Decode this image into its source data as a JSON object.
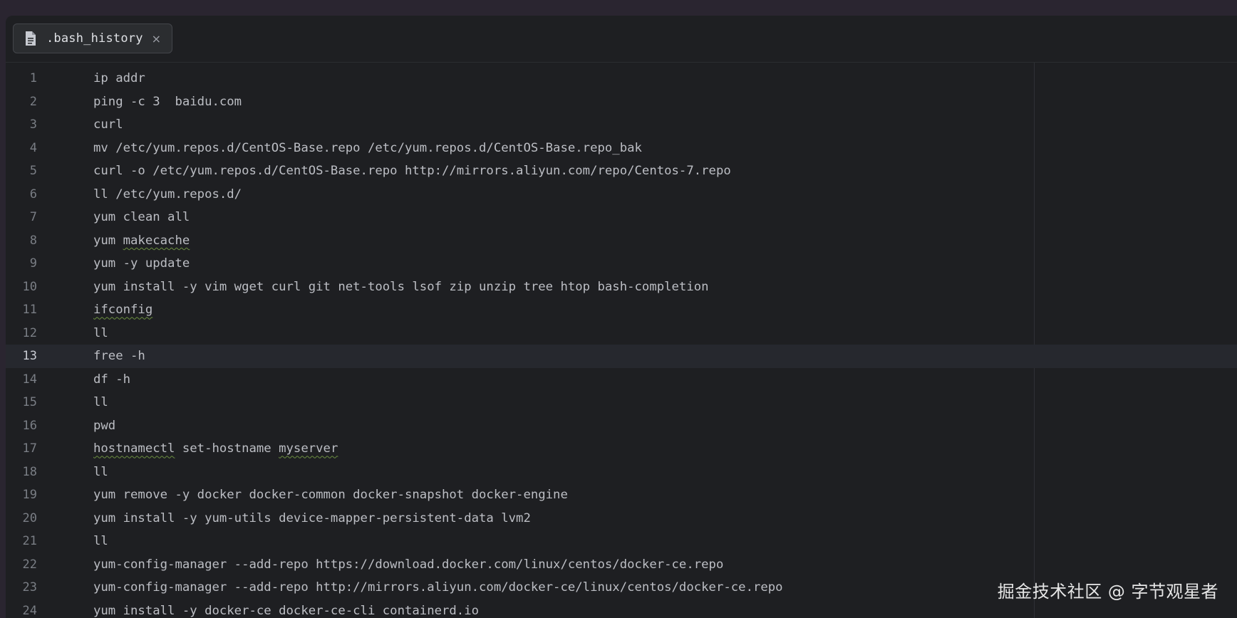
{
  "tab": {
    "label": ".bash_history",
    "icon": "file-icon",
    "close_glyph": "×"
  },
  "editor": {
    "current_line": 13,
    "lines": [
      {
        "n": "1",
        "text": "ip addr"
      },
      {
        "n": "2",
        "text": "ping -c 3  baidu.com"
      },
      {
        "n": "3",
        "text": "curl"
      },
      {
        "n": "4",
        "text": "mv /etc/yum.repos.d/CentOS-Base.repo /etc/yum.repos.d/CentOS-Base.repo_bak"
      },
      {
        "n": "5",
        "text": "curl -o /etc/yum.repos.d/CentOS-Base.repo http://mirrors.aliyun.com/repo/Centos-7.repo"
      },
      {
        "n": "6",
        "text": "ll /etc/yum.repos.d/"
      },
      {
        "n": "7",
        "text": "yum clean all"
      },
      {
        "n": "8",
        "text": "yum makecache",
        "typos": [
          "makecache"
        ]
      },
      {
        "n": "9",
        "text": "yum -y update"
      },
      {
        "n": "10",
        "text": "yum install -y vim wget curl git net-tools lsof zip unzip tree htop bash-completion"
      },
      {
        "n": "11",
        "text": "ifconfig",
        "typos": [
          "ifconfig"
        ]
      },
      {
        "n": "12",
        "text": "ll"
      },
      {
        "n": "13",
        "text": "free -h"
      },
      {
        "n": "14",
        "text": "df -h"
      },
      {
        "n": "15",
        "text": "ll"
      },
      {
        "n": "16",
        "text": "pwd"
      },
      {
        "n": "17",
        "text": "hostnamectl set-hostname myserver",
        "typos": [
          "hostnamectl",
          "myserver"
        ]
      },
      {
        "n": "18",
        "text": "ll"
      },
      {
        "n": "19",
        "text": "yum remove -y docker docker-common docker-snapshot docker-engine"
      },
      {
        "n": "20",
        "text": "yum install -y yum-utils device-mapper-persistent-data lvm2"
      },
      {
        "n": "21",
        "text": "ll"
      },
      {
        "n": "22",
        "text": "yum-config-manager --add-repo https://download.docker.com/linux/centos/docker-ce.repo"
      },
      {
        "n": "23",
        "text": "yum-config-manager --add-repo http://mirrors.aliyun.com/docker-ce/linux/centos/docker-ce.repo"
      },
      {
        "n": "24",
        "text": "yum install -y docker-ce docker-ce-cli containerd.io"
      }
    ]
  },
  "watermark": "掘金技术社区 @ 字节观星者",
  "colors": {
    "background": "#1e1f22",
    "text": "#bcbec4",
    "gutter": "#7a7e85",
    "current_line": "#26282e",
    "typo_underline": "#6b8f3f"
  }
}
